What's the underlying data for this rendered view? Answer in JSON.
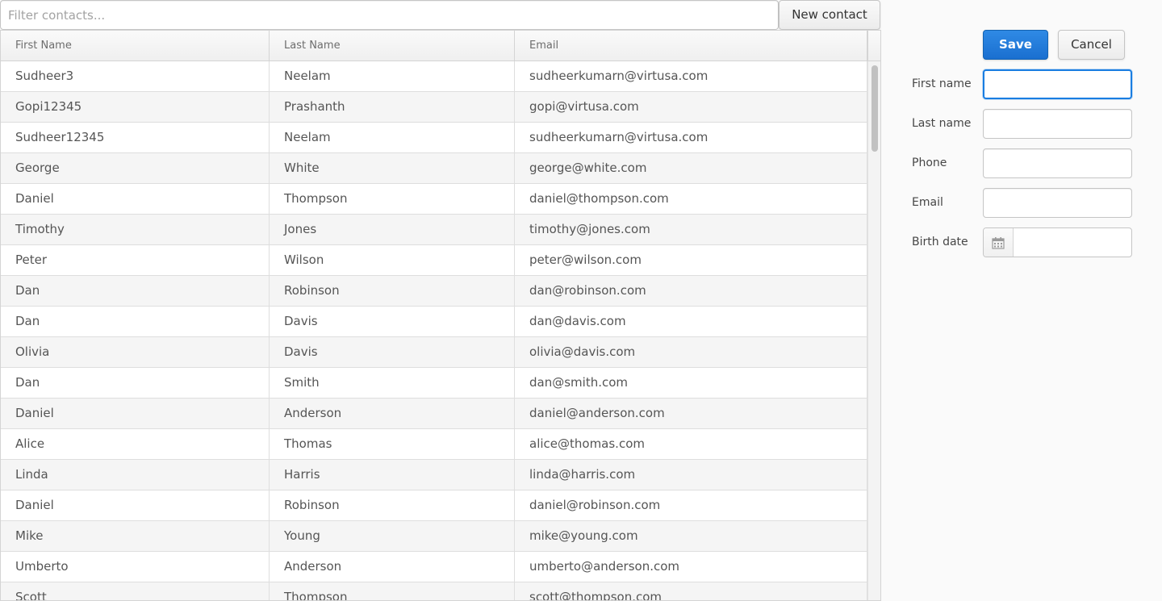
{
  "toolbar": {
    "filter_placeholder": "Filter contacts...",
    "filter_value": "",
    "new_contact_label": "New contact"
  },
  "grid": {
    "columns": [
      "First Name",
      "Last Name",
      "Email"
    ],
    "rows": [
      [
        "Sudheer3",
        "Neelam",
        "sudheerkumarn@virtusa.com"
      ],
      [
        "Gopi12345",
        "Prashanth",
        "gopi@virtusa.com"
      ],
      [
        "Sudheer12345",
        "Neelam",
        "sudheerkumarn@virtusa.com"
      ],
      [
        "George",
        "White",
        "george@white.com"
      ],
      [
        "Daniel",
        "Thompson",
        "daniel@thompson.com"
      ],
      [
        "Timothy",
        "Jones",
        "timothy@jones.com"
      ],
      [
        "Peter",
        "Wilson",
        "peter@wilson.com"
      ],
      [
        "Dan",
        "Robinson",
        "dan@robinson.com"
      ],
      [
        "Dan",
        "Davis",
        "dan@davis.com"
      ],
      [
        "Olivia",
        "Davis",
        "olivia@davis.com"
      ],
      [
        "Dan",
        "Smith",
        "dan@smith.com"
      ],
      [
        "Daniel",
        "Anderson",
        "daniel@anderson.com"
      ],
      [
        "Alice",
        "Thomas",
        "alice@thomas.com"
      ],
      [
        "Linda",
        "Harris",
        "linda@harris.com"
      ],
      [
        "Daniel",
        "Robinson",
        "daniel@robinson.com"
      ],
      [
        "Mike",
        "Young",
        "mike@young.com"
      ],
      [
        "Umberto",
        "Anderson",
        "umberto@anderson.com"
      ],
      [
        "Scott",
        "Thompson",
        "scott@thompson.com"
      ]
    ]
  },
  "form": {
    "save_label": "Save",
    "cancel_label": "Cancel",
    "fields": {
      "first_name": {
        "label": "First name",
        "value": ""
      },
      "last_name": {
        "label": "Last name",
        "value": ""
      },
      "phone": {
        "label": "Phone",
        "value": ""
      },
      "email": {
        "label": "Email",
        "value": ""
      },
      "birth_date": {
        "label": "Birth date",
        "value": ""
      }
    }
  },
  "icons": {
    "calendar": "calendar-icon"
  },
  "colors": {
    "accent": "#197de1",
    "save_button": "#1a6fd0"
  }
}
